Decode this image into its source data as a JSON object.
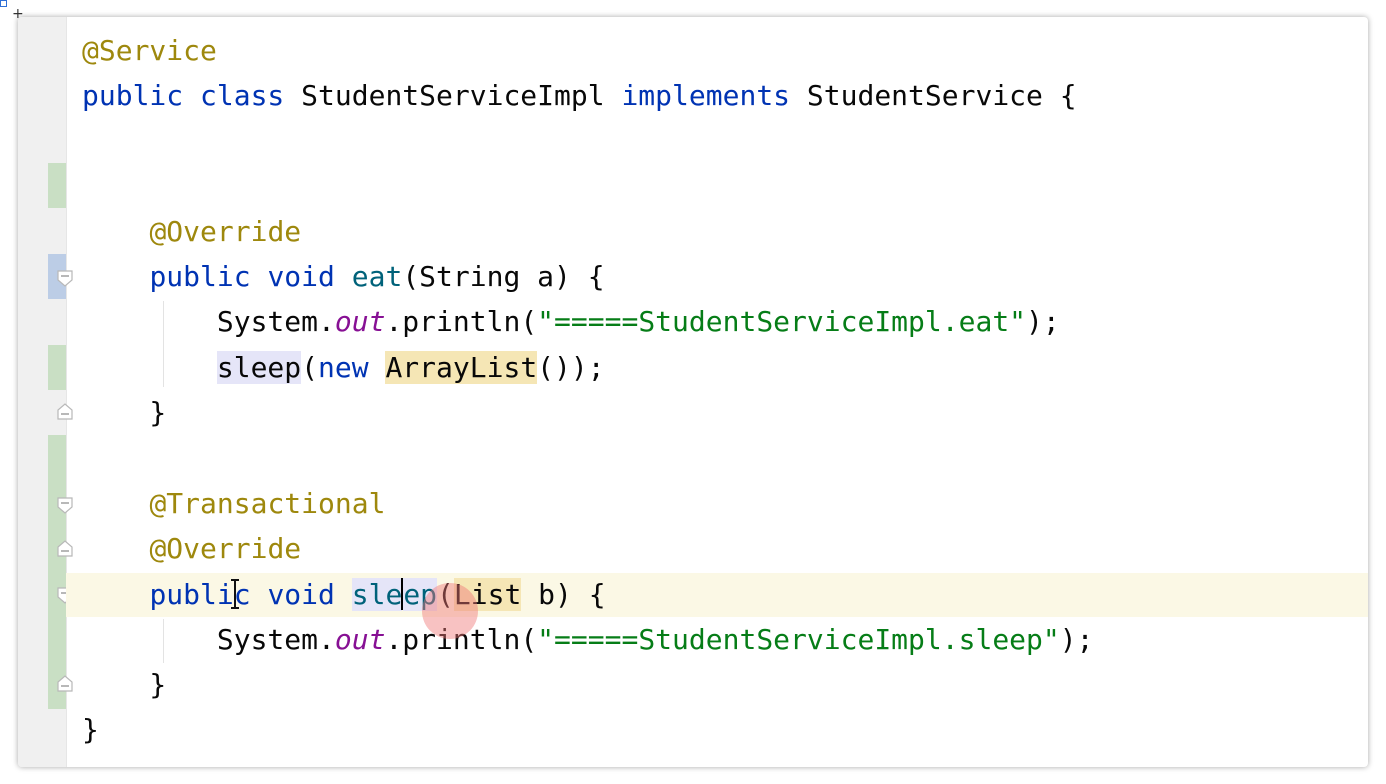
{
  "editor": {
    "lines": [
      {
        "key": "l1",
        "segments": [
          {
            "t": "@Service",
            "c": "ann"
          }
        ]
      },
      {
        "key": "l2",
        "segments": [
          {
            "t": "public class",
            "c": "kw"
          },
          {
            "t": " StudentServiceImpl "
          },
          {
            "t": "implements",
            "c": "kw"
          },
          {
            "t": " StudentService {"
          }
        ]
      },
      {
        "key": "l5",
        "segments": [
          {
            "t": "    "
          },
          {
            "t": "@Override",
            "c": "ann"
          }
        ]
      },
      {
        "key": "l6",
        "segments": [
          {
            "t": "    "
          },
          {
            "t": "public void",
            "c": "kw"
          },
          {
            "t": " "
          },
          {
            "t": "eat",
            "c": "method-decl"
          },
          {
            "t": "(String a) {"
          }
        ]
      },
      {
        "key": "l7",
        "segments": [
          {
            "t": "        System."
          },
          {
            "t": "out",
            "c": "static-field"
          },
          {
            "t": ".println("
          },
          {
            "t": "\"=====StudentServiceImpl.eat\"",
            "c": "str"
          },
          {
            "t": ");"
          }
        ]
      },
      {
        "key": "l8",
        "segments": [
          {
            "t": "        "
          },
          {
            "t": "sleep",
            "c": "hl-usage"
          },
          {
            "t": "("
          },
          {
            "t": "new",
            "c": "kw"
          },
          {
            "t": " "
          },
          {
            "t": "ArrayList",
            "c": "hl-warn"
          },
          {
            "t": "());"
          }
        ]
      },
      {
        "key": "l9",
        "segments": [
          {
            "t": "    }"
          }
        ]
      },
      {
        "key": "l11",
        "segments": [
          {
            "t": "    "
          },
          {
            "t": "@Transactional",
            "c": "ann"
          }
        ]
      },
      {
        "key": "l12",
        "segments": [
          {
            "t": "    "
          },
          {
            "t": "@Override",
            "c": "ann"
          }
        ]
      },
      {
        "key": "l13",
        "segments": [
          {
            "t": "    "
          },
          {
            "t": "public void",
            "c": "kw"
          },
          {
            "t": " "
          },
          {
            "t": "sle",
            "c": "method-decl hl-usage"
          },
          {
            "t": "",
            "c": "caret"
          },
          {
            "t": "ep",
            "c": "method-decl hl-usage"
          },
          {
            "t": "("
          },
          {
            "t": "List",
            "c": "hl-warn"
          },
          {
            "t": " b) {"
          }
        ]
      },
      {
        "key": "l14",
        "segments": [
          {
            "t": "        System."
          },
          {
            "t": "out",
            "c": "static-field"
          },
          {
            "t": ".println("
          },
          {
            "t": "\"=====StudentServiceImpl.sleep\"",
            "c": "str"
          },
          {
            "t": ");"
          }
        ]
      },
      {
        "key": "l15",
        "segments": [
          {
            "t": "    }"
          }
        ]
      },
      {
        "key": "l16",
        "segments": [
          {
            "t": "}"
          }
        ]
      }
    ]
  },
  "colors": {
    "keyword": "#0033b3",
    "annotation": "#9e880d",
    "string": "#067d17",
    "static_field": "#871094",
    "method_declaration": "#00627a",
    "usage_highlight": "#e5e5f8",
    "warning_highlight": "#f5e6b5",
    "caret_row": "#fbf8e5",
    "vcs_added": "#c9dfc4",
    "vcs_modified": "#bccde6"
  },
  "gutter": {
    "change_markers": [
      "added",
      "modified",
      "added",
      "added"
    ],
    "fold_icons": [
      "fold-start-icon",
      "fold-end-icon",
      "fold-start-icon",
      "fold-end-icon",
      "fold-start-icon",
      "fold-end-icon"
    ]
  },
  "cursor": {
    "icon": "text-ibeam-cursor-icon",
    "click_indicator": "click-ripple-icon"
  }
}
